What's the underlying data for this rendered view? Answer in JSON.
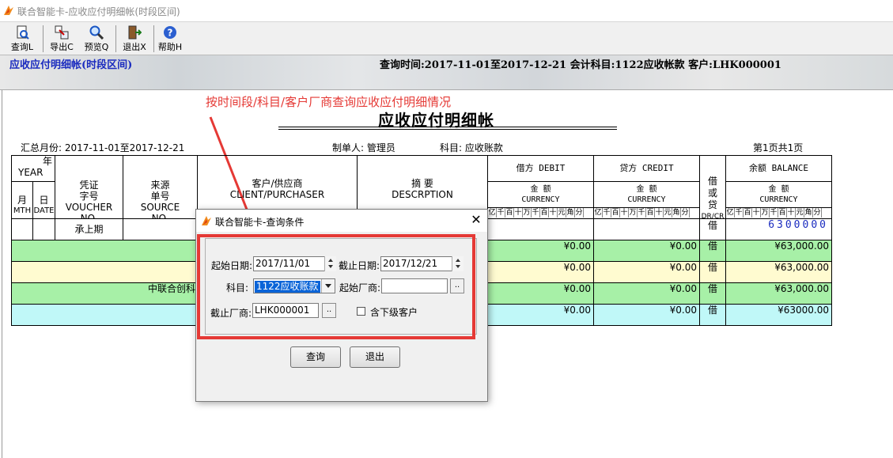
{
  "window": {
    "title": "联合智能卡-应收应付明细帐(时段区间)"
  },
  "toolbar": {
    "query": "查询L",
    "export": "导出C",
    "preview": "预览Q",
    "exit": "退出X",
    "help": "帮助H"
  },
  "banner": {
    "left": "应收应付明细帐(时段区间)",
    "right": "查询时间:2017-11-01至2017-12-21  会计科目:1122应收帐款  客户:LHK000001"
  },
  "annotation": "按时间段/科目/客户厂商查询应收应付明细情况",
  "report": {
    "title": "应收应付明细帐",
    "summary_month": "汇总月份: 2017-11-01至2017-12-21",
    "maker": "制单人: 管理员",
    "subject": "科目: 应收账款",
    "page": "第1页共1页",
    "headers": {
      "nian": "年",
      "year": "YEAR",
      "yue": "月",
      "mth": "MTH",
      "ri": "日",
      "date": "DATE",
      "voucher_cn": "凭证\n字号",
      "voucher_en": "VOUCHER\nNO.",
      "source_cn": "来源\n单号",
      "source_en": "SOURCE\nNO.",
      "client_cn": "客户/供应商",
      "client_en": "CLIENT/PURCHASER",
      "desc_cn": "摘    要",
      "desc_en": "DESCRPTION",
      "debit": "借方 DEBIT",
      "credit": "贷方 CREDIT",
      "amount_cn": "金 额",
      "currency": "CURRENCY",
      "dc_cn": "借\n或\n贷",
      "dc_en": "DR/CR",
      "balance": "余额 BALANCE",
      "digit_units": [
        "亿",
        "千",
        "百",
        "十",
        "万",
        "千",
        "百",
        "十",
        "元",
        "角",
        "分"
      ]
    },
    "rows": [
      {
        "source": "承上期",
        "dc": "借",
        "balance": "6300000"
      },
      {
        "client": "",
        "debit": "¥0.00",
        "credit": "¥0.00",
        "dc": "借",
        "balance": "¥63,000.00"
      },
      {
        "client": "",
        "debit": "¥0.00",
        "credit": "¥0.00",
        "dc": "借",
        "balance": "¥63,000.00"
      },
      {
        "client": "中联合创科",
        "debit": "¥0.00",
        "credit": "¥0.00",
        "dc": "借",
        "balance": "¥63,000.00"
      },
      {
        "client": "",
        "debit": "¥0.00",
        "credit": "¥0.00",
        "dc": "借",
        "balance": "¥63000.00"
      }
    ]
  },
  "dialog": {
    "title": "联合智能卡-查询条件",
    "close": "✕",
    "start_date_label": "起始日期:",
    "start_date": "2017/11/01",
    "end_date_label": "截止日期:",
    "end_date": "2017/12/21",
    "subject_label": "科目:",
    "subject_value": "1122应收账款",
    "start_vendor_label": "起始厂商:",
    "start_vendor": "",
    "end_vendor_label": "截止厂商:",
    "end_vendor": "LHK000001",
    "include_sub_label": "含下级客户",
    "browse": "..",
    "query_button": "查询",
    "exit_button": "退出"
  },
  "colors": {
    "annotation": "#e53935",
    "row_green": "#a7f0a7",
    "row_yellow": "#fffbd0",
    "row_cyan": "#c0f8f8",
    "banner_title": "#1a2bbf"
  }
}
